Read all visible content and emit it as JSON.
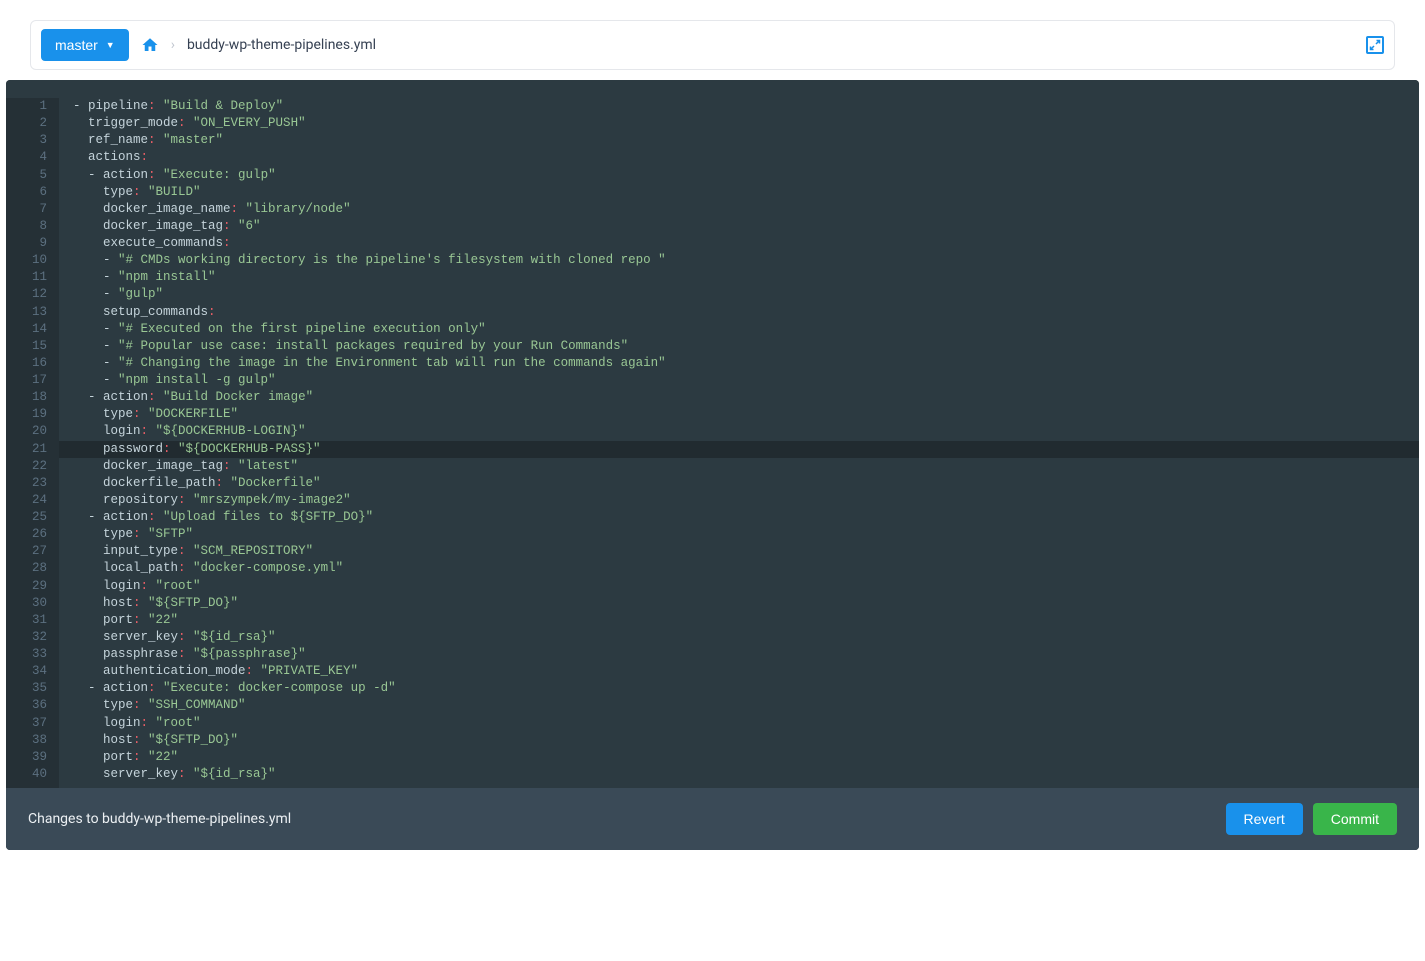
{
  "breadcrumb": {
    "branch_label": "master",
    "file_name": "buddy-wp-theme-pipelines.yml"
  },
  "footer": {
    "changes_text": "Changes to buddy-wp-theme-pipelines.yml",
    "revert_label": "Revert",
    "commit_label": "Commit"
  },
  "editor": {
    "highlighted_line": 21,
    "lines": [
      {
        "n": 1,
        "t": [
          {
            "c": "dash",
            "v": "- "
          },
          {
            "c": "key",
            "v": "pipeline"
          },
          {
            "c": "colon",
            "v": ": "
          },
          {
            "c": "string",
            "v": "\"Build & Deploy\""
          }
        ]
      },
      {
        "n": 2,
        "t": [
          {
            "c": "key",
            "v": "  trigger_mode"
          },
          {
            "c": "colon",
            "v": ": "
          },
          {
            "c": "string",
            "v": "\"ON_EVERY_PUSH\""
          }
        ]
      },
      {
        "n": 3,
        "t": [
          {
            "c": "key",
            "v": "  ref_name"
          },
          {
            "c": "colon",
            "v": ": "
          },
          {
            "c": "string",
            "v": "\"master\""
          }
        ]
      },
      {
        "n": 4,
        "t": [
          {
            "c": "key",
            "v": "  actions"
          },
          {
            "c": "colon",
            "v": ":"
          }
        ]
      },
      {
        "n": 5,
        "t": [
          {
            "c": "dash",
            "v": "  - "
          },
          {
            "c": "key",
            "v": "action"
          },
          {
            "c": "colon",
            "v": ": "
          },
          {
            "c": "string",
            "v": "\"Execute: gulp\""
          }
        ]
      },
      {
        "n": 6,
        "t": [
          {
            "c": "key",
            "v": "    type"
          },
          {
            "c": "colon",
            "v": ": "
          },
          {
            "c": "string",
            "v": "\"BUILD\""
          }
        ]
      },
      {
        "n": 7,
        "t": [
          {
            "c": "key",
            "v": "    docker_image_name"
          },
          {
            "c": "colon",
            "v": ": "
          },
          {
            "c": "string",
            "v": "\"library/node\""
          }
        ]
      },
      {
        "n": 8,
        "t": [
          {
            "c": "key",
            "v": "    docker_image_tag"
          },
          {
            "c": "colon",
            "v": ": "
          },
          {
            "c": "string",
            "v": "\"6\""
          }
        ]
      },
      {
        "n": 9,
        "t": [
          {
            "c": "key",
            "v": "    execute_commands"
          },
          {
            "c": "colon",
            "v": ":"
          }
        ]
      },
      {
        "n": 10,
        "t": [
          {
            "c": "dash",
            "v": "    - "
          },
          {
            "c": "string",
            "v": "\"# CMDs working directory is the pipeline's filesystem with cloned repo \""
          }
        ]
      },
      {
        "n": 11,
        "t": [
          {
            "c": "dash",
            "v": "    - "
          },
          {
            "c": "string",
            "v": "\"npm install\""
          }
        ]
      },
      {
        "n": 12,
        "t": [
          {
            "c": "dash",
            "v": "    - "
          },
          {
            "c": "string",
            "v": "\"gulp\""
          }
        ]
      },
      {
        "n": 13,
        "t": [
          {
            "c": "key",
            "v": "    setup_commands"
          },
          {
            "c": "colon",
            "v": ":"
          }
        ]
      },
      {
        "n": 14,
        "t": [
          {
            "c": "dash",
            "v": "    - "
          },
          {
            "c": "string",
            "v": "\"# Executed on the first pipeline execution only\""
          }
        ]
      },
      {
        "n": 15,
        "t": [
          {
            "c": "dash",
            "v": "    - "
          },
          {
            "c": "string",
            "v": "\"# Popular use case: install packages required by your Run Commands\""
          }
        ]
      },
      {
        "n": 16,
        "t": [
          {
            "c": "dash",
            "v": "    - "
          },
          {
            "c": "string",
            "v": "\"# Changing the image in the Environment tab will run the commands again\""
          }
        ]
      },
      {
        "n": 17,
        "t": [
          {
            "c": "dash",
            "v": "    - "
          },
          {
            "c": "string",
            "v": "\"npm install -g gulp\""
          }
        ]
      },
      {
        "n": 18,
        "t": [
          {
            "c": "dash",
            "v": "  - "
          },
          {
            "c": "key",
            "v": "action"
          },
          {
            "c": "colon",
            "v": ": "
          },
          {
            "c": "string",
            "v": "\"Build Docker image\""
          }
        ]
      },
      {
        "n": 19,
        "t": [
          {
            "c": "key",
            "v": "    type"
          },
          {
            "c": "colon",
            "v": ": "
          },
          {
            "c": "string",
            "v": "\"DOCKERFILE\""
          }
        ]
      },
      {
        "n": 20,
        "t": [
          {
            "c": "key",
            "v": "    login"
          },
          {
            "c": "colon",
            "v": ": "
          },
          {
            "c": "string",
            "v": "\"${DOCKERHUB-LOGIN}\""
          }
        ]
      },
      {
        "n": 21,
        "t": [
          {
            "c": "key",
            "v": "    password"
          },
          {
            "c": "colon",
            "v": ": "
          },
          {
            "c": "string",
            "v": "\"${DOCKERHUB-PASS}\""
          }
        ]
      },
      {
        "n": 22,
        "t": [
          {
            "c": "key",
            "v": "    docker_image_tag"
          },
          {
            "c": "colon",
            "v": ": "
          },
          {
            "c": "string",
            "v": "\"latest\""
          }
        ]
      },
      {
        "n": 23,
        "t": [
          {
            "c": "key",
            "v": "    dockerfile_path"
          },
          {
            "c": "colon",
            "v": ": "
          },
          {
            "c": "string",
            "v": "\"Dockerfile\""
          }
        ]
      },
      {
        "n": 24,
        "t": [
          {
            "c": "key",
            "v": "    repository"
          },
          {
            "c": "colon",
            "v": ": "
          },
          {
            "c": "string",
            "v": "\"mrszympek/my-image2\""
          }
        ]
      },
      {
        "n": 25,
        "t": [
          {
            "c": "dash",
            "v": "  - "
          },
          {
            "c": "key",
            "v": "action"
          },
          {
            "c": "colon",
            "v": ": "
          },
          {
            "c": "string",
            "v": "\"Upload files to ${SFTP_DO}\""
          }
        ]
      },
      {
        "n": 26,
        "t": [
          {
            "c": "key",
            "v": "    type"
          },
          {
            "c": "colon",
            "v": ": "
          },
          {
            "c": "string",
            "v": "\"SFTP\""
          }
        ]
      },
      {
        "n": 27,
        "t": [
          {
            "c": "key",
            "v": "    input_type"
          },
          {
            "c": "colon",
            "v": ": "
          },
          {
            "c": "string",
            "v": "\"SCM_REPOSITORY\""
          }
        ]
      },
      {
        "n": 28,
        "t": [
          {
            "c": "key",
            "v": "    local_path"
          },
          {
            "c": "colon",
            "v": ": "
          },
          {
            "c": "string",
            "v": "\"docker-compose.yml\""
          }
        ]
      },
      {
        "n": 29,
        "t": [
          {
            "c": "key",
            "v": "    login"
          },
          {
            "c": "colon",
            "v": ": "
          },
          {
            "c": "string",
            "v": "\"root\""
          }
        ]
      },
      {
        "n": 30,
        "t": [
          {
            "c": "key",
            "v": "    host"
          },
          {
            "c": "colon",
            "v": ": "
          },
          {
            "c": "string",
            "v": "\"${SFTP_DO}\""
          }
        ]
      },
      {
        "n": 31,
        "t": [
          {
            "c": "key",
            "v": "    port"
          },
          {
            "c": "colon",
            "v": ": "
          },
          {
            "c": "string",
            "v": "\"22\""
          }
        ]
      },
      {
        "n": 32,
        "t": [
          {
            "c": "key",
            "v": "    server_key"
          },
          {
            "c": "colon",
            "v": ": "
          },
          {
            "c": "string",
            "v": "\"${id_rsa}\""
          }
        ]
      },
      {
        "n": 33,
        "t": [
          {
            "c": "key",
            "v": "    passphrase"
          },
          {
            "c": "colon",
            "v": ": "
          },
          {
            "c": "string",
            "v": "\"${passphrase}\""
          }
        ]
      },
      {
        "n": 34,
        "t": [
          {
            "c": "key",
            "v": "    authentication_mode"
          },
          {
            "c": "colon",
            "v": ": "
          },
          {
            "c": "string",
            "v": "\"PRIVATE_KEY\""
          }
        ]
      },
      {
        "n": 35,
        "t": [
          {
            "c": "dash",
            "v": "  - "
          },
          {
            "c": "key",
            "v": "action"
          },
          {
            "c": "colon",
            "v": ": "
          },
          {
            "c": "string",
            "v": "\"Execute: docker-compose up -d\""
          }
        ]
      },
      {
        "n": 36,
        "t": [
          {
            "c": "key",
            "v": "    type"
          },
          {
            "c": "colon",
            "v": ": "
          },
          {
            "c": "string",
            "v": "\"SSH_COMMAND\""
          }
        ]
      },
      {
        "n": 37,
        "t": [
          {
            "c": "key",
            "v": "    login"
          },
          {
            "c": "colon",
            "v": ": "
          },
          {
            "c": "string",
            "v": "\"root\""
          }
        ]
      },
      {
        "n": 38,
        "t": [
          {
            "c": "key",
            "v": "    host"
          },
          {
            "c": "colon",
            "v": ": "
          },
          {
            "c": "string",
            "v": "\"${SFTP_DO}\""
          }
        ]
      },
      {
        "n": 39,
        "t": [
          {
            "c": "key",
            "v": "    port"
          },
          {
            "c": "colon",
            "v": ": "
          },
          {
            "c": "string",
            "v": "\"22\""
          }
        ]
      },
      {
        "n": 40,
        "t": [
          {
            "c": "key",
            "v": "    server_key"
          },
          {
            "c": "colon",
            "v": ": "
          },
          {
            "c": "string",
            "v": "\"${id_rsa}\""
          }
        ]
      }
    ]
  }
}
